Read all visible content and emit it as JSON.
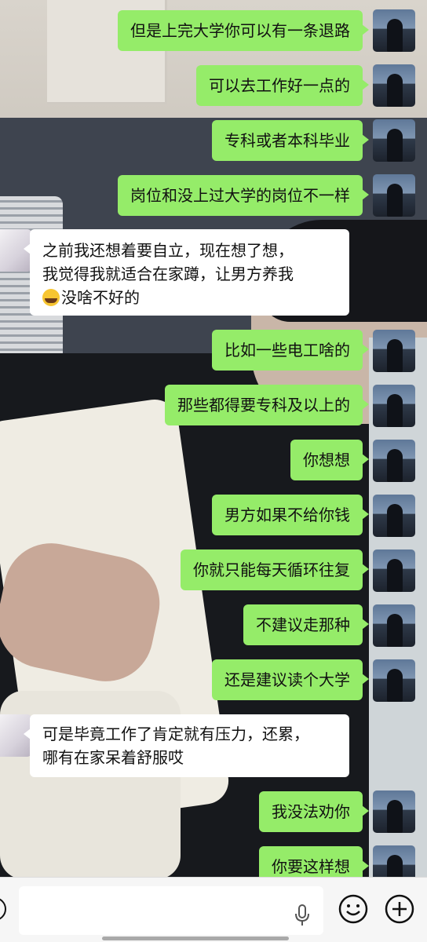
{
  "messages": [
    {
      "from": "me",
      "text": "但是上完大学你可以有一条退路"
    },
    {
      "from": "me",
      "text": "可以去工作好一点的"
    },
    {
      "from": "me",
      "text": "专科或者本科毕业"
    },
    {
      "from": "me",
      "text": "岗位和没上过大学的岗位不一样"
    },
    {
      "from": "them",
      "lines": [
        "之前我还想着要自立，现在想了想，",
        "我觉得我就适合在家蹲，让男方养我",
        "没啥不好的"
      ],
      "emoji": "loudly-crying-face-icon"
    },
    {
      "from": "me",
      "text": "比如一些电工啥的"
    },
    {
      "from": "me",
      "text": "那些都得要专科及以上的"
    },
    {
      "from": "me",
      "text": "你想想"
    },
    {
      "from": "me",
      "text": "男方如果不给你钱"
    },
    {
      "from": "me",
      "text": "你就只能每天循环往复"
    },
    {
      "from": "me",
      "text": "不建议走那种"
    },
    {
      "from": "me",
      "text": "还是建议读个大学"
    },
    {
      "from": "them",
      "lines": [
        "可是毕竟工作了肯定就有压力，还累，",
        "哪有在家呆着舒服哎"
      ]
    },
    {
      "from": "me",
      "text": "我没法劝你"
    },
    {
      "from": "me",
      "text": "你要这样想"
    }
  ],
  "input_bar": {
    "value": "",
    "icons": [
      "voice-icon",
      "mic-icon",
      "emoji-icon",
      "plus-icon"
    ]
  },
  "colors": {
    "outgoing_bubble": "#95ec69",
    "incoming_bubble": "#ffffff",
    "input_bar": "#f6f6f6"
  }
}
